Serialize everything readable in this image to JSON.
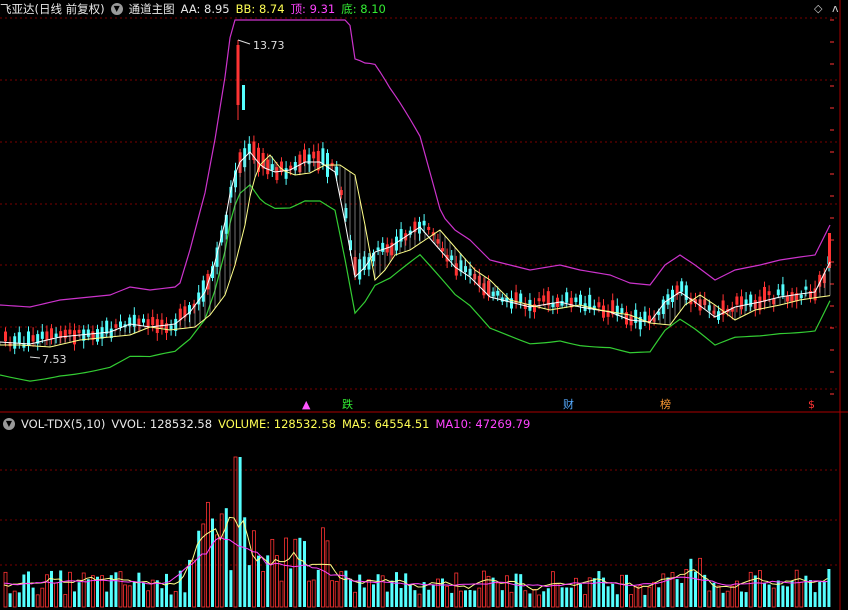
{
  "main_header": {
    "stock_name": "飞亚达(日线 前复权)",
    "indicator_name": "通道主图",
    "aa_label": "AA: 8.95",
    "bb_label": "BB: 8.74",
    "top_label": "顶: 9.31",
    "bottom_label": "底: 8.10"
  },
  "vol_header": {
    "indicator_name": "VOL-TDX(5,10)",
    "vvol_label": "VVOL: 128532.58",
    "volume_label": "VOLUME: 128532.58",
    "ma5_label": "MA5: 64554.51",
    "ma10_label": "MA10: 47269.79"
  },
  "price_annotations": {
    "high": "13.73",
    "low": "7.53"
  },
  "event_markers": [
    {
      "kind": "up-arrow",
      "label": "▲",
      "color": "#ff55ff"
    },
    {
      "kind": "down",
      "label": "跌",
      "color": "#33ee33"
    },
    {
      "kind": "finance",
      "label": "财",
      "color": "#55aaff"
    },
    {
      "kind": "ranking",
      "label": "榜",
      "color": "#ff9933"
    },
    {
      "kind": "signal",
      "label": "$",
      "color": "#ff3333"
    }
  ],
  "colors": {
    "up": "#ff3333",
    "down": "#55ffff",
    "channel_top": "#cc33cc",
    "channel_bottom": "#33cc33",
    "ma_white": "#ffffff",
    "ma_yellow": "#ffff88",
    "vol_ma5": "#ffff88",
    "vol_ma10": "#ff44ff",
    "grid": "#7a0000"
  },
  "corner_icons": [
    "settings-diamond-icon",
    "collapse-icon"
  ]
}
